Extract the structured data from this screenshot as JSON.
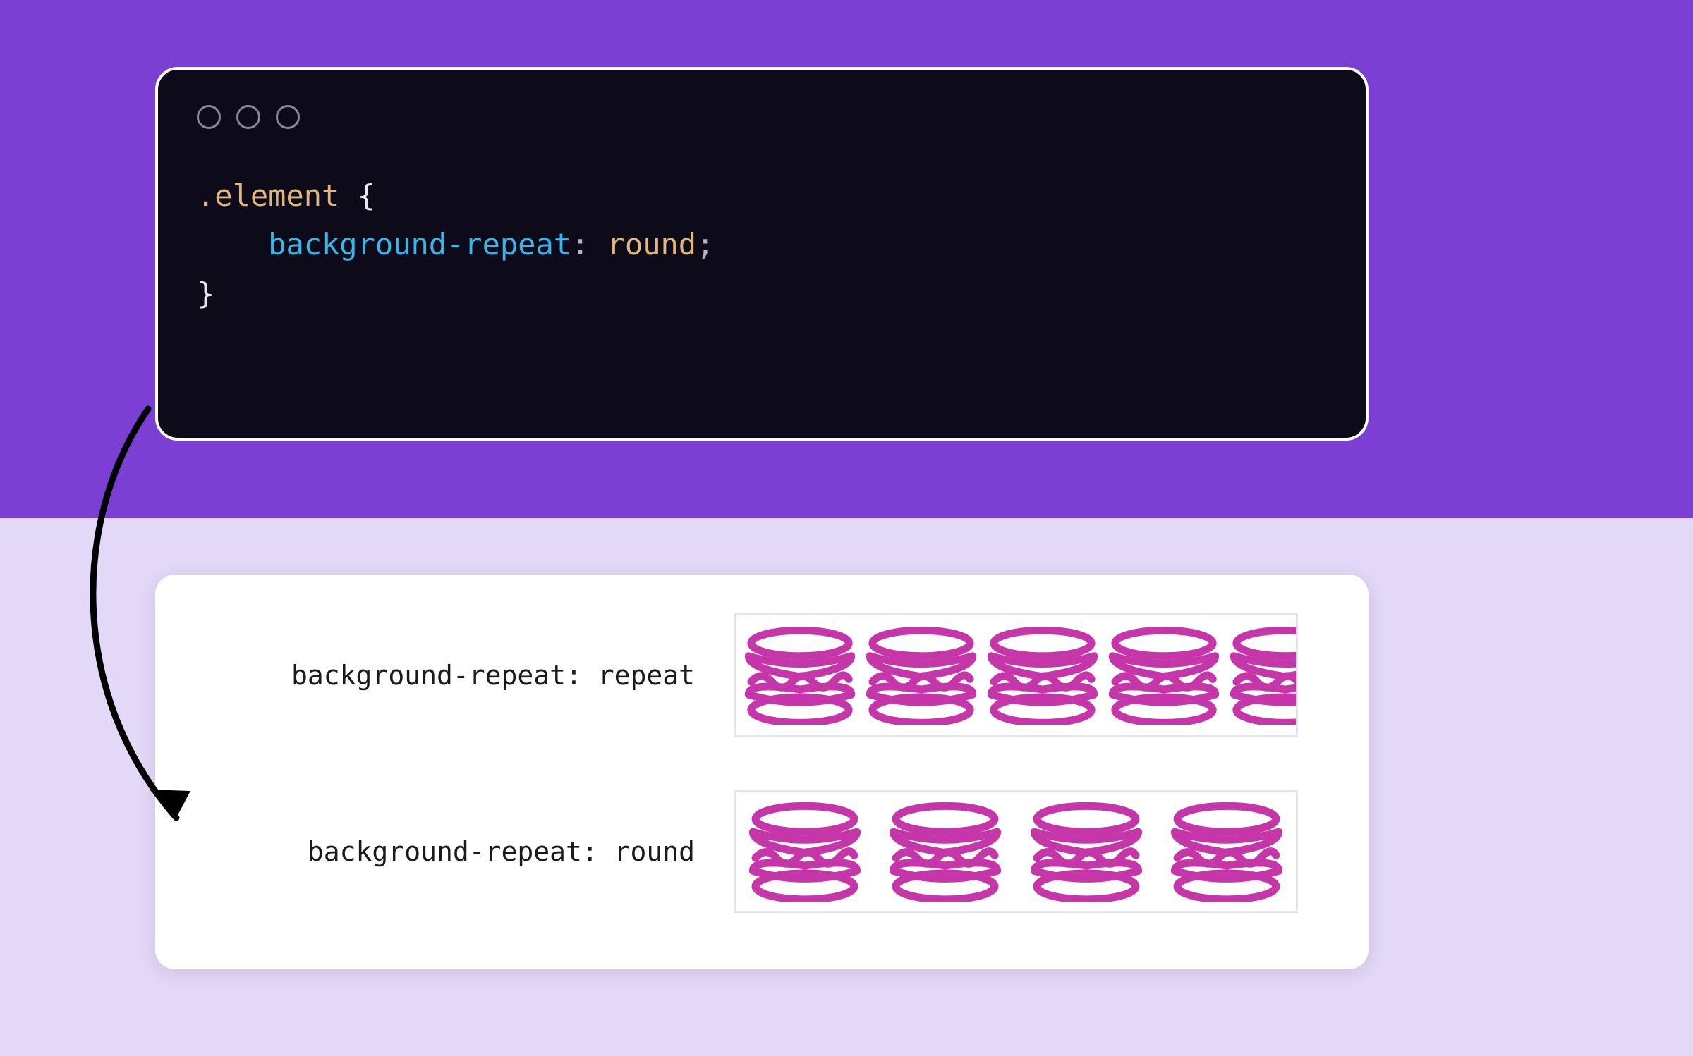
{
  "colors": {
    "band": "#7b3fd4",
    "page": "#e3d8f7",
    "code_bg": "#0d0b1a",
    "icon": "#c537a8"
  },
  "code": {
    "selector": ".element",
    "brace_open": "{",
    "property": "background-repeat",
    "colon": ":",
    "value": "round",
    "semicolon": ";",
    "brace_close": "}"
  },
  "demos": [
    {
      "label": "background-repeat: repeat",
      "mode": "repeat",
      "icon_count": 5
    },
    {
      "label": "background-repeat: round",
      "mode": "round",
      "icon_count": 4
    }
  ]
}
